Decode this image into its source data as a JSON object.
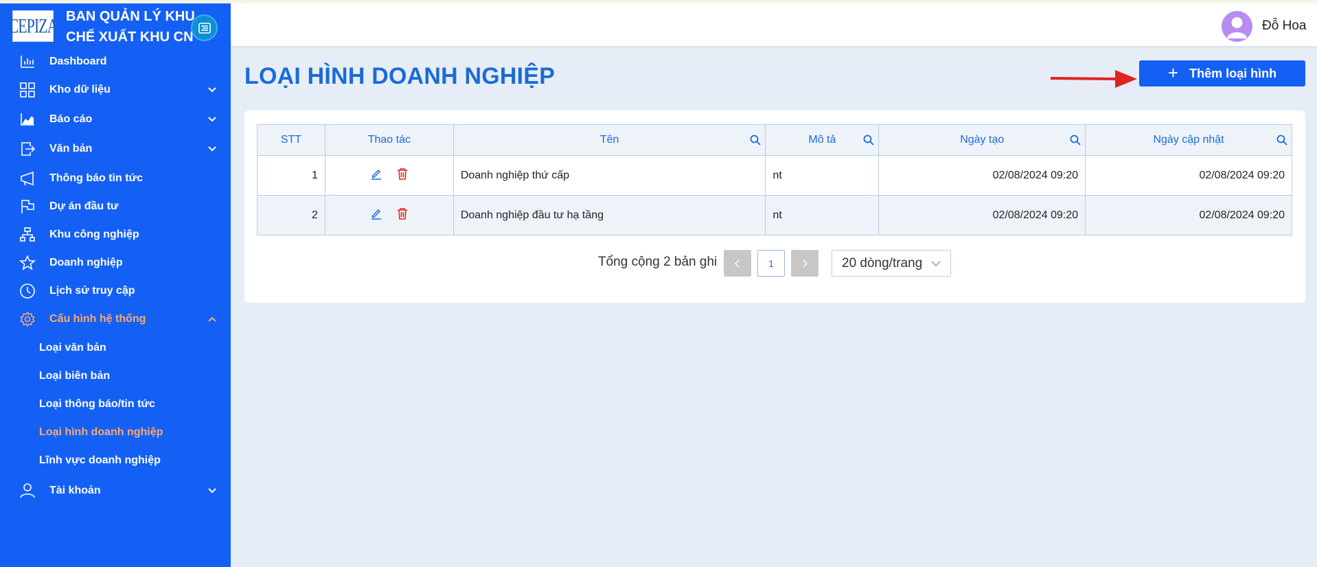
{
  "sidebar": {
    "logo_text": "CEPIZA",
    "brand_line1": "BAN QUẢN LÝ KHU",
    "brand_line2": "CHẾ XUẤT KHU CN",
    "items": [
      {
        "label": "Dashboard",
        "icon": "bar-chart-icon"
      },
      {
        "label": "Kho dữ liệu",
        "icon": "grid-icon"
      },
      {
        "label": "Báo cáo",
        "icon": "area-chart-icon"
      },
      {
        "label": "Văn bản",
        "icon": "document-export-icon"
      },
      {
        "label": "Thông báo tin tức",
        "icon": "megaphone-icon"
      },
      {
        "label": "Dự án đầu tư",
        "icon": "flag-icon"
      },
      {
        "label": "Khu công nghiệp",
        "icon": "cluster-icon"
      },
      {
        "label": "Doanh nghiệp",
        "icon": "star-icon"
      },
      {
        "label": "Lịch sử truy cập",
        "icon": "clock-icon"
      },
      {
        "label": "Cấu hình hệ thống",
        "icon": "gear-icon"
      },
      {
        "label": "Tài khoản",
        "icon": "user-icon"
      }
    ],
    "sub_items": [
      {
        "label": "Loại văn bản"
      },
      {
        "label": "Loại biên bản"
      },
      {
        "label": "Loại thông báo/tin tức"
      },
      {
        "label": "Loại hình doanh nghiệp"
      },
      {
        "label": "Lĩnh vực doanh nghiệp"
      }
    ]
  },
  "header": {
    "username": "Đỗ Hoa"
  },
  "page": {
    "title": "LOẠI HÌNH DOANH NGHIỆP",
    "add_button": "Thêm loại hình"
  },
  "table": {
    "columns": [
      "STT",
      "Thao tác",
      "Tên",
      "Mô tả",
      "Ngày tạo",
      "Ngày cập nhật"
    ],
    "rows": [
      {
        "stt": "1",
        "name": "Doanh nghiệp thứ cấp",
        "desc": "nt",
        "created": "02/08/2024 09:20",
        "updated": "02/08/2024 09:20"
      },
      {
        "stt": "2",
        "name": "Doanh nghiệp đầu tư hạ tầng",
        "desc": "nt",
        "created": "02/08/2024 09:20",
        "updated": "02/08/2024 09:20"
      }
    ]
  },
  "pagination": {
    "total_text": "Tổng cộng 2 bản ghi",
    "current_page": "1",
    "page_size": "20 dòng/trang"
  },
  "colors": {
    "primary": "#1460f5",
    "title": "#1a6bd6",
    "active": "#ffa86a",
    "danger": "#e5271b"
  }
}
